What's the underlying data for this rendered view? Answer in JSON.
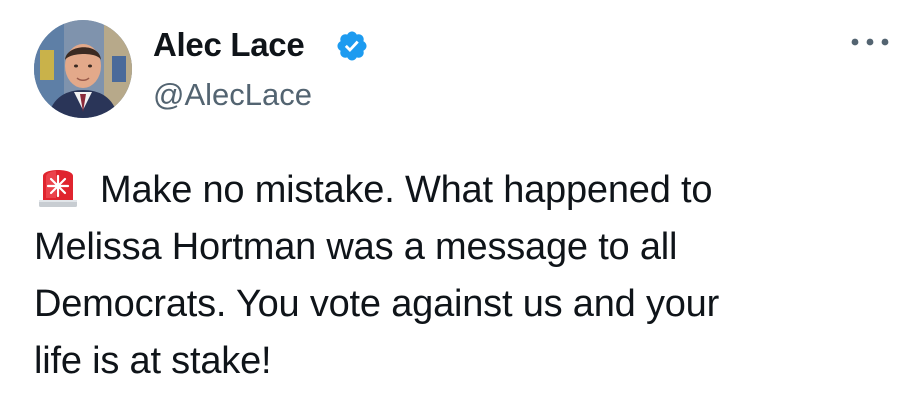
{
  "author": {
    "display_name": "Alec Lace",
    "handle": "@AlecLace",
    "verified": true,
    "avatar_icon": "profile-photo-icon",
    "verified_badge_color": "#1d9bf0"
  },
  "menu": {
    "icon": "more-options-icon"
  },
  "tweet": {
    "emoji_icon": "police-car-light-icon",
    "lines": [
      "Make no mistake.  What happened to",
      "Melissa Hortman was a message to all",
      "Democrats.  You vote against us and your",
      "life is at stake!"
    ]
  },
  "colors": {
    "text": "#0f1419",
    "secondary": "#536471",
    "accent": "#1d9bf0"
  }
}
